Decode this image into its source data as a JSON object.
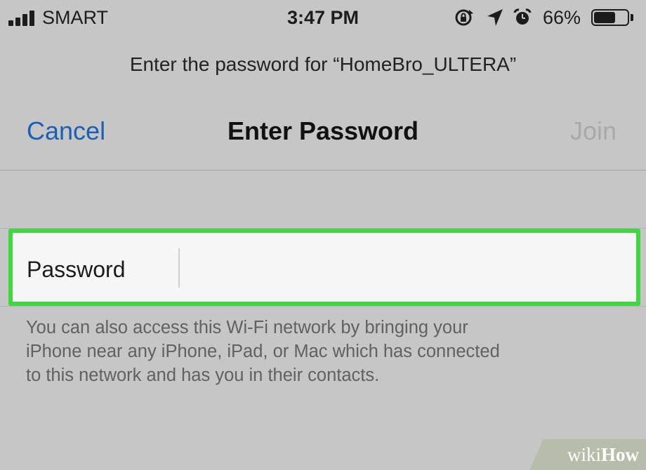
{
  "status_bar": {
    "carrier": "SMART",
    "time": "3:47 PM",
    "battery_percent": "66%",
    "battery_level": 0.66,
    "icons": [
      "signal-icon",
      "orientation-lock-icon",
      "location-arrow-icon",
      "alarm-icon",
      "battery-icon"
    ]
  },
  "prompt": "Enter the password for “HomeBro_ULTERA”",
  "nav": {
    "cancel_label": "Cancel",
    "title": "Enter Password",
    "join_label": "Join"
  },
  "password_field": {
    "label": "Password",
    "value": "",
    "highlight_color": "#3fd73f"
  },
  "footnote_lines": [
    "You can also access this Wi-Fi network by bringing your",
    "iPhone near any iPhone, iPad, or Mac which has connected",
    "to this network and has you in their contacts."
  ],
  "colors": {
    "accent": "#1a60b6",
    "disabled": "#a9a9a9",
    "background": "#c6c6c6"
  },
  "watermark": {
    "wiki": "wiki",
    "how": "How"
  }
}
